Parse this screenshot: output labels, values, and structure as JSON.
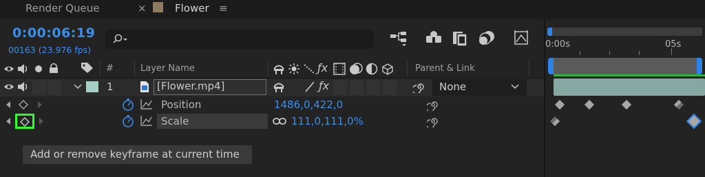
{
  "tabs": [
    {
      "label": "Render Queue"
    },
    {
      "label": "Flower"
    }
  ],
  "tab_close_glyph": "×",
  "tab_menu_glyph": "≡",
  "timecode": "0:00:06:19",
  "frame_info": "00163 (23.976 fps)",
  "search": {
    "placeholder": ""
  },
  "ruler": {
    "labels": [
      "0:00s",
      "05s"
    ]
  },
  "columns": {
    "layer_name": "Layer Name",
    "number": "#",
    "parent_link": "Parent & Link"
  },
  "layer": {
    "index": "1",
    "name": "[Flower.mp4]",
    "parent": "None",
    "color": "#a6cfc8"
  },
  "properties": [
    {
      "label": "Position",
      "value": "1486,0,422,0"
    },
    {
      "label": "Scale",
      "value": "111,0,111,0%"
    }
  ],
  "tooltip": "Add or remove keyframe at current time",
  "colors": {
    "accent": "#3b8ee8",
    "work_area": "#2d82e6",
    "highlight": "#2cff2c",
    "green_bar": "#36b03b"
  },
  "icons": {
    "eye": "eye-icon",
    "audio": "speaker-icon",
    "solo": "solo-dot-icon",
    "lock": "lock-icon",
    "label": "tag-icon",
    "stopwatch": "stopwatch-icon",
    "graph": "graph-icon",
    "pickwhip": "pickwhip-spiral-icon",
    "link": "constrain-proportions-icon"
  }
}
